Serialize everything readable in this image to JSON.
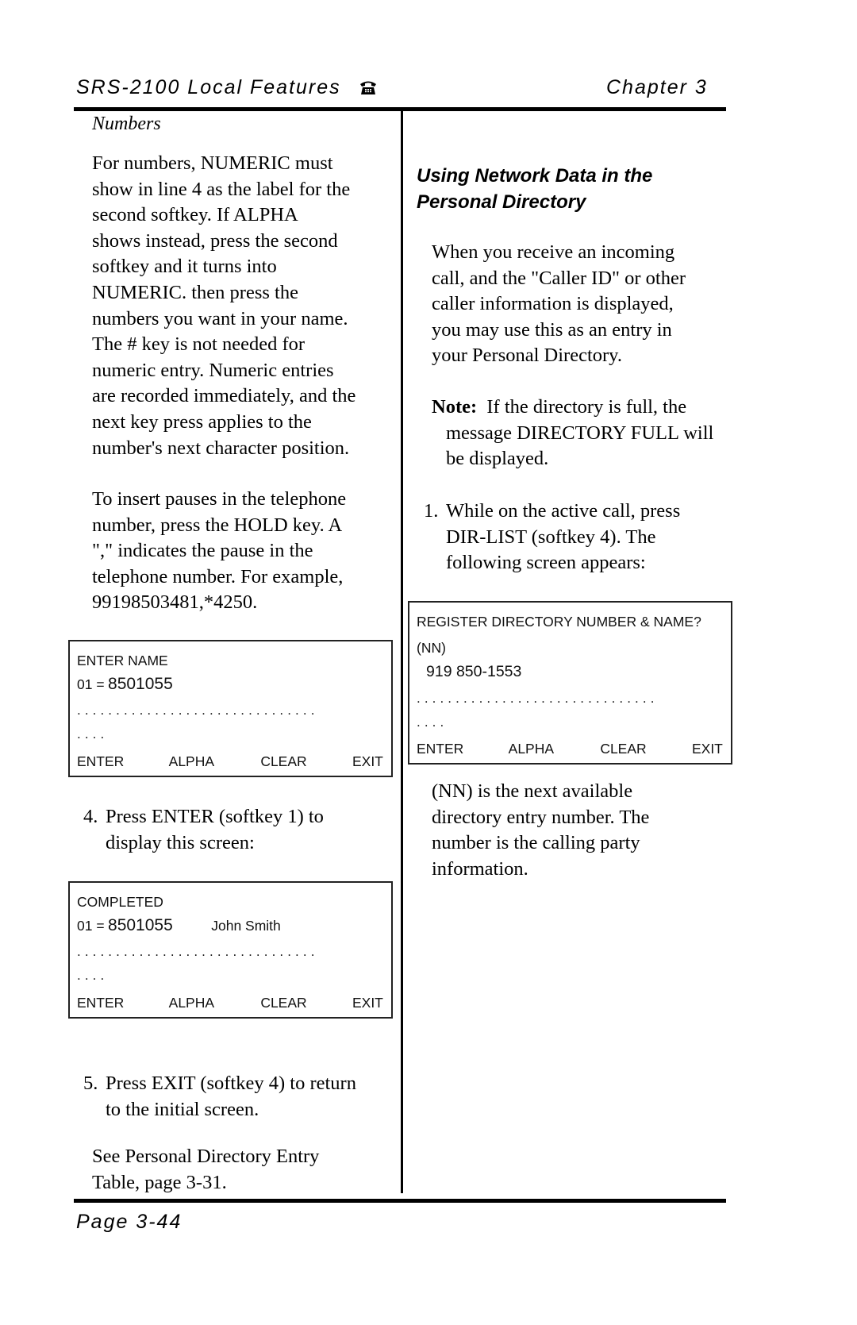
{
  "header": {
    "title": "SRS-2100 Local Features",
    "icon": "telephone-icon",
    "chapter": "Chapter 3"
  },
  "left": {
    "subhead": "Numbers",
    "para1": [
      "For numbers, NUMERIC must",
      "show in line 4 as the label for the",
      "second softkey.  If ALPHA",
      "shows instead, press the second",
      "softkey and it turns into",
      "NUMERIC.  then press the",
      "numbers you want in your name.",
      "The # key is not needed for",
      "numeric entry.  Numeric entries",
      "are recorded immediately, and the",
      "next key press applies to the",
      "number's next character position."
    ],
    "para2": [
      "To insert pauses in the telephone",
      "number, press the HOLD key.  A",
      "\",\" indicates the pause in the",
      "telephone number.  For example,",
      "99198503481,*4250."
    ],
    "screen1": {
      "line1": "ENTER NAME",
      "entry_prefix": "01 =",
      "entry_number": "8501055",
      "dots_line1": "...............................",
      "dots_line2": "....",
      "softkeys": [
        "ENTER",
        "ALPHA",
        "CLEAR",
        "EXIT"
      ]
    },
    "step4": {
      "num": "4.",
      "lines": [
        "Press ENTER (softkey 1) to",
        "display this screen:"
      ]
    },
    "screen2": {
      "line1": "COMPLETED",
      "entry_prefix": "01 =",
      "entry_number": "8501055",
      "entry_name": "John Smith",
      "dots_line1": "...............................",
      "dots_line2": "....",
      "softkeys": [
        "ENTER",
        "ALPHA",
        "CLEAR",
        "EXIT"
      ]
    },
    "step5": {
      "num": "5.",
      "lines": [
        "Press EXIT (softkey 4) to return",
        "to the initial screen."
      ]
    },
    "see_also": [
      "See Personal Directory Entry",
      "Table, page 3-31."
    ]
  },
  "right": {
    "heading": [
      "Using Network Data in the",
      "Personal Directory"
    ],
    "intro": [
      "When you receive an incoming",
      "call, and the \"Caller ID\" or other",
      "caller information is displayed,",
      "you may use this as an entry in",
      "your Personal Directory."
    ],
    "note": {
      "label": "Note:",
      "lines": [
        "If the directory is full, the",
        "message DIRECTORY FULL will",
        "be displayed."
      ]
    },
    "step1": {
      "num": "1.",
      "lines": [
        "While on the active call, press",
        "DIR-LIST (softkey 4).  The",
        "following screen appears:"
      ]
    },
    "screen3": {
      "line1": "REGISTER DIRECTORY NUMBER & NAME?",
      "line2": "(NN)",
      "number": "919 850-1553",
      "dots_line1": "...............................",
      "dots_line2": "....",
      "softkeys": [
        "ENTER",
        "ALPHA",
        "CLEAR",
        "EXIT"
      ]
    },
    "explain": [
      "(NN) is the next available",
      "directory entry number.  The",
      "number is the calling party",
      "information."
    ]
  },
  "footer": {
    "page": "Page 3-44"
  }
}
